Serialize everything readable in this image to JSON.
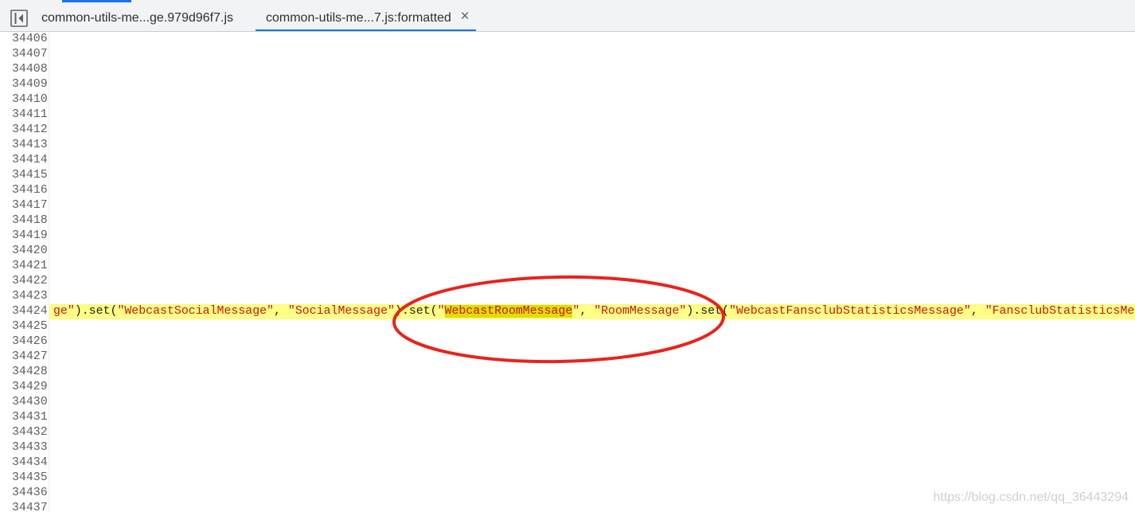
{
  "colors": {
    "accent": "#1a73e8",
    "annotation": "#e8231d"
  },
  "icons": {
    "navigator_toggle": "sidebar-toggle-icon",
    "tab_close": "close-icon"
  },
  "tabs": [
    {
      "label": "common-utils-me...ge.979d96f7.js",
      "active": false
    },
    {
      "label": "common-utils-me...7.js:formatted",
      "active": true,
      "close_glyph": "×"
    }
  ],
  "editor": {
    "lines": [
      {
        "number": "34406"
      },
      {
        "number": "34407"
      },
      {
        "number": "34408"
      },
      {
        "number": "34409"
      },
      {
        "number": "34410"
      },
      {
        "number": "34411"
      },
      {
        "number": "34412"
      },
      {
        "number": "34413"
      },
      {
        "number": "34414"
      },
      {
        "number": "34415"
      },
      {
        "number": "34416"
      },
      {
        "number": "34417"
      },
      {
        "number": "34418"
      },
      {
        "number": "34419"
      },
      {
        "number": "34420"
      },
      {
        "number": "34421"
      },
      {
        "number": "34422"
      },
      {
        "number": "34423"
      },
      {
        "number": "34424",
        "background": "#fefe86",
        "tokens": [
          {
            "text": "ge\"",
            "color": "#c41a16"
          },
          {
            "text": ").set(",
            "color": "#222222"
          },
          {
            "text": "\"WebcastSocialMessage\"",
            "color": "#c41a16"
          },
          {
            "text": ", ",
            "color": "#222222"
          },
          {
            "text": "\"SocialMessage\"",
            "color": "#c41a16"
          },
          {
            "text": ").set(",
            "color": "#222222"
          },
          {
            "text": "\"",
            "color": "#c41a16"
          },
          {
            "text": "WebcastRoomMessage",
            "color": "#c41a16",
            "background": "#e1dc04"
          },
          {
            "text": "\"",
            "color": "#c41a16"
          },
          {
            "text": ", ",
            "color": "#222222"
          },
          {
            "text": "\"RoomMessage\"",
            "color": "#c41a16"
          },
          {
            "text": ").set(",
            "color": "#222222"
          },
          {
            "text": "\"WebcastFansclubStatisticsMessage\"",
            "color": "#c41a16"
          },
          {
            "text": ", ",
            "color": "#222222"
          },
          {
            "text": "\"FansclubStatisticsMes",
            "color": "#c41a16"
          }
        ]
      },
      {
        "number": "34425"
      },
      {
        "number": "34426"
      },
      {
        "number": "34427"
      },
      {
        "number": "34428"
      },
      {
        "number": "34429"
      },
      {
        "number": "34430"
      },
      {
        "number": "34431"
      },
      {
        "number": "34432"
      },
      {
        "number": "34433"
      },
      {
        "number": "34434"
      },
      {
        "number": "34435"
      },
      {
        "number": "34436"
      },
      {
        "number": "34437"
      }
    ]
  },
  "watermark": "https://blog.csdn.net/qq_36443294"
}
